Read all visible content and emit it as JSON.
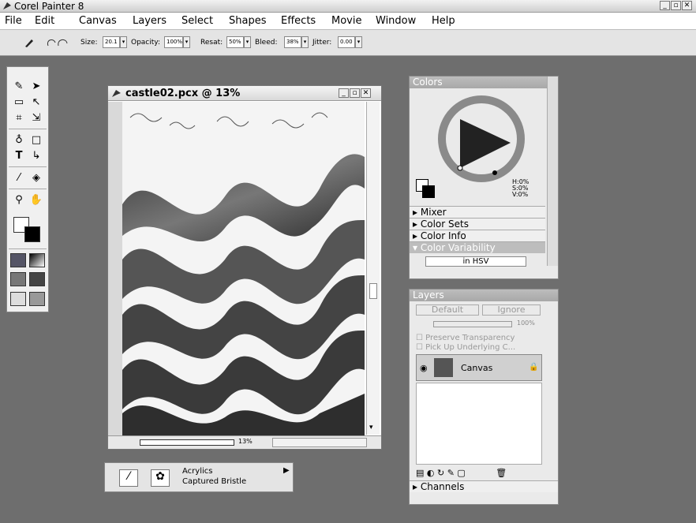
{
  "window": {
    "title": "Corel Painter 8",
    "controls": [
      "_",
      "▫",
      "✕"
    ]
  },
  "menu": [
    "File",
    "Edit",
    "Canvas",
    "Layers",
    "Select",
    "Shapes",
    "Effects",
    "Movie",
    "Window",
    "Help"
  ],
  "propbar": {
    "size_label": "Size:",
    "size_value": "20.1",
    "opacity_label": "Opacity:",
    "opacity_value": "100%",
    "resat_label": "Resat:",
    "resat_value": "50%",
    "bleed_label": "Bleed:",
    "bleed_value": "38%",
    "jitter_label": "Jitter:",
    "jitter_value": "0.00"
  },
  "document": {
    "title": "castle02.pcx @ 13%",
    "zoom": "13%"
  },
  "colors_panel": {
    "title": "Colors",
    "hsv": [
      "H:0%",
      "S:0%",
      "V:0%"
    ],
    "collapsed": [
      "Mixer",
      "Color Sets",
      "Color Info"
    ],
    "variability_title": "Color Variability",
    "variability_mode": "in HSV"
  },
  "layers_panel": {
    "title": "Layers",
    "composite_method": "Default",
    "composite_depth": "Ignore",
    "opacity": "100%",
    "preserve_transparency": "Preserve Transparency",
    "pick_up_underlying": "Pick Up Underlying C...",
    "layer_name": "Canvas",
    "channels_title": "Channels"
  },
  "brush": {
    "category": "Acrylics",
    "variant": "Captured Bristle"
  },
  "colors": {
    "accent_triangle": "#222222",
    "wheel": "#8a8a8a",
    "workspace": "#6e6e6e"
  }
}
